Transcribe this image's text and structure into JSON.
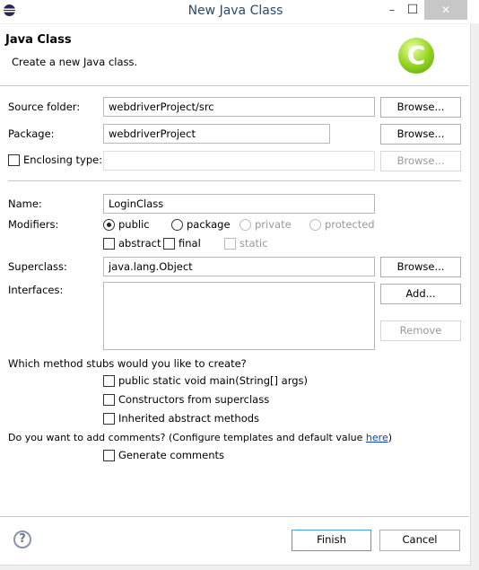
{
  "window": {
    "title": "New Java Class",
    "minimize": "–",
    "maximize": "☐",
    "close": "✕"
  },
  "header": {
    "title": "Java Class",
    "subtitle": "Create a new Java class.",
    "icon": "java-class-icon",
    "icon_letter": "C"
  },
  "form": {
    "source_folder": {
      "label": "Source folder:",
      "value": "webdriverProject/src",
      "browse": "Browse..."
    },
    "package": {
      "label": "Package:",
      "value": "webdriverProject",
      "browse": "Browse..."
    },
    "enclosing": {
      "label": "Enclosing type:",
      "value": "",
      "browse": "Browse...",
      "checked": false
    },
    "name": {
      "label": "Name:",
      "value": "LoginClass"
    },
    "modifiers": {
      "label": "Modifiers:",
      "public": "public",
      "package": "package",
      "private": "private",
      "protected": "protected",
      "abstract": "abstract",
      "final": "final",
      "static": "static",
      "selected": "public"
    },
    "superclass": {
      "label": "Superclass:",
      "value": "java.lang.Object",
      "browse": "Browse..."
    },
    "interfaces": {
      "label": "Interfaces:",
      "add": "Add...",
      "remove": "Remove"
    },
    "stubs": {
      "question": "Which method stubs would you like to create?",
      "main": "public static void main(String[] args)",
      "constructors": "Constructors from superclass",
      "inherited": "Inherited abstract methods"
    },
    "comments": {
      "question": "Do you want to add comments? (Configure templates and default value ",
      "link": "here",
      "close": ")",
      "generate": "Generate comments"
    }
  },
  "footer": {
    "help": "?",
    "finish": "Finish",
    "cancel": "Cancel"
  }
}
